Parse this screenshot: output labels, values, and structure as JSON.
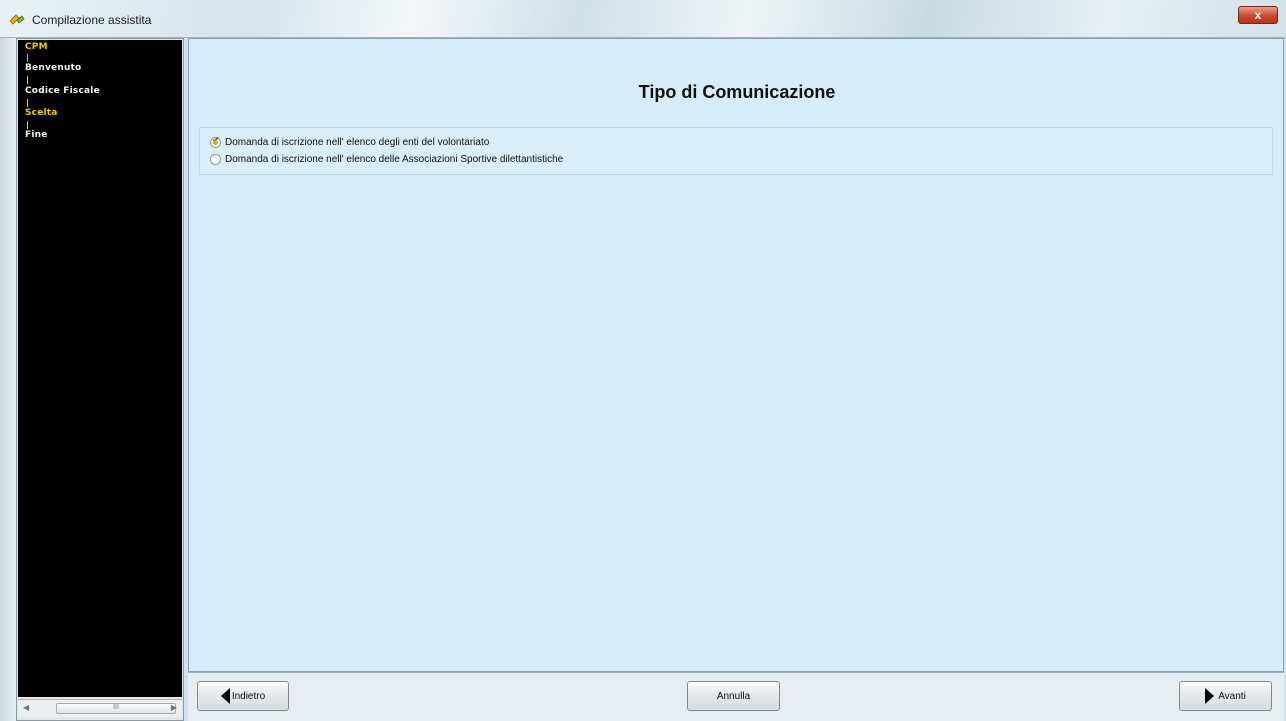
{
  "window": {
    "title": "Compilazione assistita",
    "close_label": "x"
  },
  "sidebar": {
    "steps": [
      {
        "label": "CPM",
        "active": true
      },
      {
        "label": "Benvenuto",
        "active": false
      },
      {
        "label": "Codice Fiscale",
        "active": false
      },
      {
        "label": "Scelta",
        "active": true
      },
      {
        "label": "Fine",
        "active": false
      }
    ],
    "scroll_thumb_label": "III"
  },
  "main": {
    "title": "Tipo di Comunicazione",
    "options": [
      {
        "label": "Domanda di iscrizione nell' elenco degli enti del volontariato",
        "checked": true
      },
      {
        "label": "Domanda di iscrizione nell' elenco delle Associazioni Sportive dilettantistiche",
        "checked": false
      }
    ]
  },
  "footer": {
    "back_label": "Indietro",
    "cancel_label": "Annulla",
    "next_label": "Avanti"
  },
  "colors": {
    "active_step": "#e8d100",
    "panel_bg": "#d6ecf8",
    "sidebar_bg": "#000000"
  }
}
